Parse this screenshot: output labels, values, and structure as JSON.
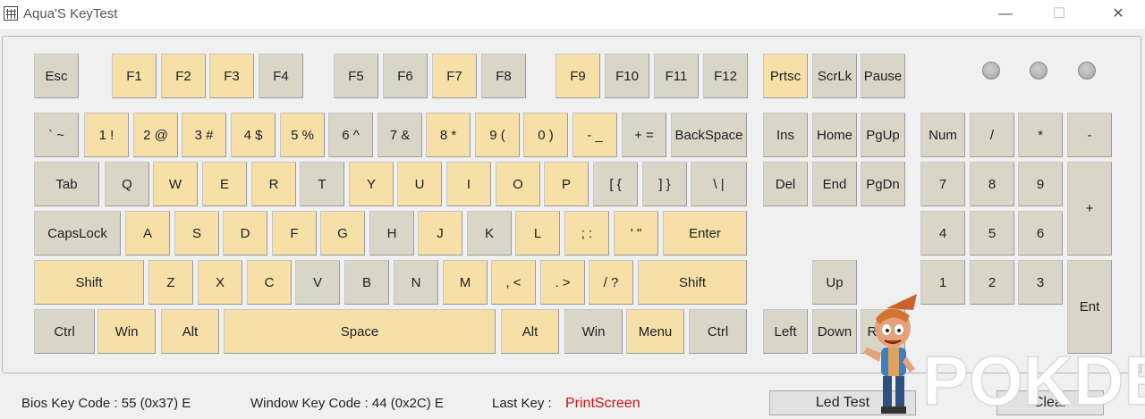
{
  "window": {
    "title": "Aqua'S KeyTest",
    "minimize": "—",
    "maximize": "☐",
    "close": "✕"
  },
  "keys": [
    {
      "label": "Esc",
      "on": false
    },
    {
      "label": "F1",
      "on": true
    },
    {
      "label": "F2",
      "on": true
    },
    {
      "label": "F3",
      "on": true
    },
    {
      "label": "F4",
      "on": false
    },
    {
      "label": "F5",
      "on": false
    },
    {
      "label": "F6",
      "on": false
    },
    {
      "label": "F7",
      "on": true
    },
    {
      "label": "F8",
      "on": false
    },
    {
      "label": "F9",
      "on": true
    },
    {
      "label": "F10",
      "on": false
    },
    {
      "label": "F11",
      "on": false
    },
    {
      "label": "F12",
      "on": false
    },
    {
      "label": "Prtsc",
      "on": true
    },
    {
      "label": "ScrLk",
      "on": false
    },
    {
      "label": "Pause",
      "on": false
    },
    {
      "label": "` ~",
      "on": false
    },
    {
      "label": "1 !",
      "on": true
    },
    {
      "label": "2 @",
      "on": true
    },
    {
      "label": "3 #",
      "on": true
    },
    {
      "label": "4 $",
      "on": true
    },
    {
      "label": "5 %",
      "on": true
    },
    {
      "label": "6 ^",
      "on": false
    },
    {
      "label": "7 &",
      "on": false
    },
    {
      "label": "8 *",
      "on": true
    },
    {
      "label": "9 (",
      "on": true
    },
    {
      "label": "0 )",
      "on": true
    },
    {
      "label": "- _",
      "on": true
    },
    {
      "label": "+ =",
      "on": false
    },
    {
      "label": "BackSpace",
      "on": false
    },
    {
      "label": "Ins",
      "on": false
    },
    {
      "label": "Home",
      "on": false
    },
    {
      "label": "PgUp",
      "on": false
    },
    {
      "label": "Num",
      "on": false
    },
    {
      "label": "/",
      "on": false
    },
    {
      "label": "*",
      "on": false
    },
    {
      "label": "-",
      "on": false
    },
    {
      "label": "Tab",
      "on": false
    },
    {
      "label": "Q",
      "on": false
    },
    {
      "label": "W",
      "on": true
    },
    {
      "label": "E",
      "on": true
    },
    {
      "label": "R",
      "on": true
    },
    {
      "label": "T",
      "on": false
    },
    {
      "label": "Y",
      "on": true
    },
    {
      "label": "U",
      "on": true
    },
    {
      "label": "I",
      "on": true
    },
    {
      "label": "O",
      "on": true
    },
    {
      "label": "P",
      "on": true
    },
    {
      "label": "[ {",
      "on": false
    },
    {
      "label": "] }",
      "on": false
    },
    {
      "label": "\\ |",
      "on": false
    },
    {
      "label": "Del",
      "on": false
    },
    {
      "label": "End",
      "on": false
    },
    {
      "label": "PgDn",
      "on": false
    },
    {
      "label": "7",
      "on": false
    },
    {
      "label": "8",
      "on": false
    },
    {
      "label": "9",
      "on": false
    },
    {
      "label": "+",
      "on": false
    },
    {
      "label": "CapsLock",
      "on": false
    },
    {
      "label": "A",
      "on": true
    },
    {
      "label": "S",
      "on": true
    },
    {
      "label": "D",
      "on": true
    },
    {
      "label": "F",
      "on": true
    },
    {
      "label": "G",
      "on": true
    },
    {
      "label": "H",
      "on": false
    },
    {
      "label": "J",
      "on": true
    },
    {
      "label": "K",
      "on": false
    },
    {
      "label": "L",
      "on": true
    },
    {
      "label": "; :",
      "on": true
    },
    {
      "label": "' \"",
      "on": true
    },
    {
      "label": "Enter",
      "on": true
    },
    {
      "label": "4",
      "on": false
    },
    {
      "label": "5",
      "on": false
    },
    {
      "label": "6",
      "on": false
    },
    {
      "label": "Shift",
      "on": true
    },
    {
      "label": "Z",
      "on": true
    },
    {
      "label": "X",
      "on": true
    },
    {
      "label": "C",
      "on": true
    },
    {
      "label": "V",
      "on": false
    },
    {
      "label": "B",
      "on": false
    },
    {
      "label": "N",
      "on": false
    },
    {
      "label": "M",
      "on": true
    },
    {
      "label": ", <",
      "on": true
    },
    {
      "label": ". >",
      "on": true
    },
    {
      "label": "/ ?",
      "on": true
    },
    {
      "label": "Shift",
      "on": true
    },
    {
      "label": "Up",
      "on": false
    },
    {
      "label": "1",
      "on": false
    },
    {
      "label": "2",
      "on": false
    },
    {
      "label": "3",
      "on": false
    },
    {
      "label": "Ent",
      "on": false
    },
    {
      "label": "Ctrl",
      "on": false
    },
    {
      "label": "Win",
      "on": true
    },
    {
      "label": "Alt",
      "on": true
    },
    {
      "label": "Space",
      "on": true
    },
    {
      "label": "Alt",
      "on": true
    },
    {
      "label": "Win",
      "on": false
    },
    {
      "label": "Menu",
      "on": true
    },
    {
      "label": "Ctrl",
      "on": false
    },
    {
      "label": "Left",
      "on": false
    },
    {
      "label": "Down",
      "on": false
    },
    {
      "label": "Right",
      "on": false
    }
  ],
  "leds": [
    "num-lock-led",
    "caps-lock-led",
    "scroll-lock-led"
  ],
  "status": {
    "bios": "Bios Key Code : 55 (0x37) E",
    "window": "Window Key Code : 44 (0x2C) E",
    "last_key_label": "Last Key :",
    "last_key_value": "PrintScreen"
  },
  "buttons": {
    "led_test": "Led Test",
    "clear": "Clear"
  },
  "watermark": {
    "text": "POKDE.NET"
  },
  "colors": {
    "key": "#d9d6c8",
    "key_hit": "#f6e0a8",
    "last_key": "#d01010"
  }
}
